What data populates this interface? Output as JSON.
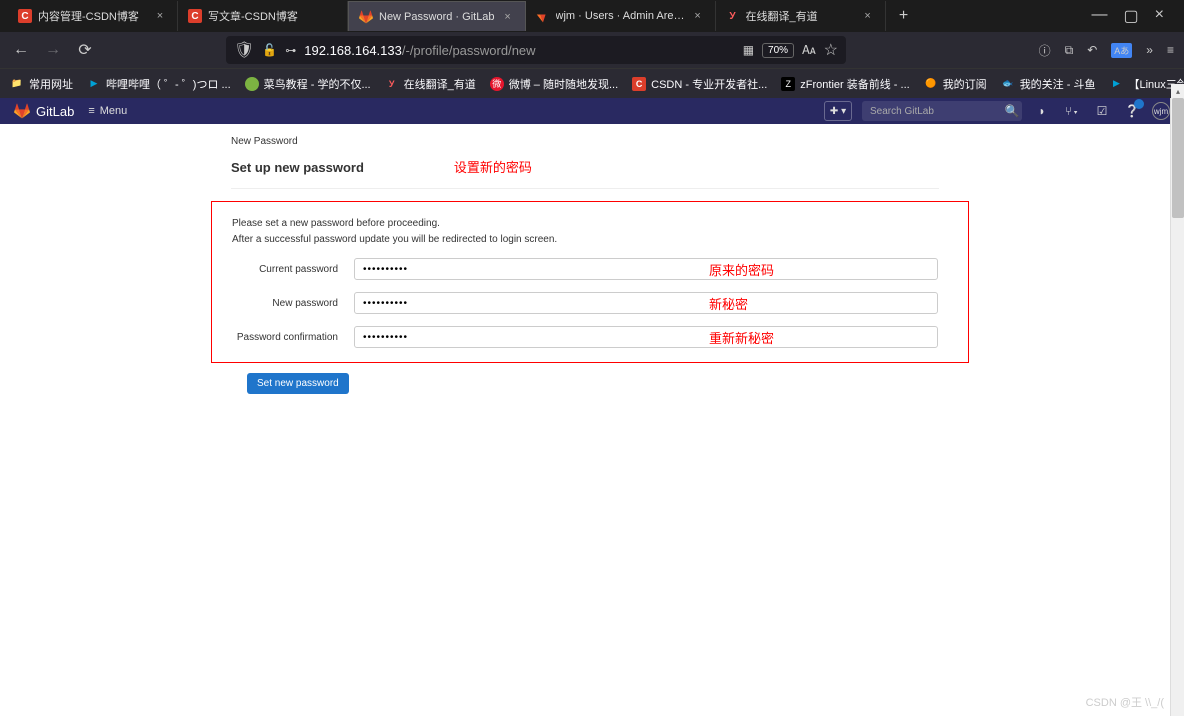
{
  "browser": {
    "tabs": [
      {
        "title": "内容管理-CSDN博客",
        "favicon": "C"
      },
      {
        "title": "写文章-CSDN博客",
        "favicon": "C"
      },
      {
        "title": "New Password · GitLab",
        "favicon": "gitlab",
        "active": true
      },
      {
        "title": "wjm · Users · Admin Area · GitLab",
        "favicon": "gitlab"
      },
      {
        "title": "在线翻译_有道",
        "favicon": "Y"
      }
    ],
    "url_host": "192.168.164.133",
    "url_path": "/-/profile/password/new",
    "zoom": "70%",
    "bookmarks": [
      {
        "label": "常用网址",
        "icon": "📁"
      },
      {
        "label": "哔哩哔哩（ ゜- ゜)つロ ...",
        "icon": "🔵"
      },
      {
        "label": "菜鸟教程 - 学的不仅...",
        "icon": "🟢"
      },
      {
        "label": "在线翻译_有道",
        "icon": "Y"
      },
      {
        "label": "微博 – 随时随地发现...",
        "icon": "🔴"
      },
      {
        "label": "CSDN - 专业开发者社...",
        "icon": "C"
      },
      {
        "label": "zFrontier 装备前线 - ...",
        "icon": "Z"
      },
      {
        "label": "我的订阅",
        "icon": "🟠"
      },
      {
        "label": "我的关注 - 斗鱼",
        "icon": "🐟"
      },
      {
        "label": "【Linux三剑客】下架...",
        "icon": "🔵"
      }
    ]
  },
  "gitlab": {
    "brand": "GitLab",
    "menu": "Menu",
    "search_placeholder": "Search GitLab",
    "avatar": "wjm"
  },
  "page": {
    "breadcrumb": "New Password",
    "title": "Set up new password",
    "title_annotation": "设置新的密码",
    "note_line1": "Please set a new password before proceeding.",
    "note_line2": "After a successful password update you will be redirected to login screen.",
    "fields": {
      "current": {
        "label": "Current password",
        "value": "••••••••••",
        "annotation": "原来的密码"
      },
      "new": {
        "label": "New password",
        "value": "••••••••••",
        "annotation": "新秘密"
      },
      "confirm": {
        "label": "Password confirmation",
        "value": "••••••••••",
        "annotation": "重新新秘密"
      }
    },
    "submit": "Set new password"
  },
  "watermark": "CSDN @王 \\\\_/("
}
